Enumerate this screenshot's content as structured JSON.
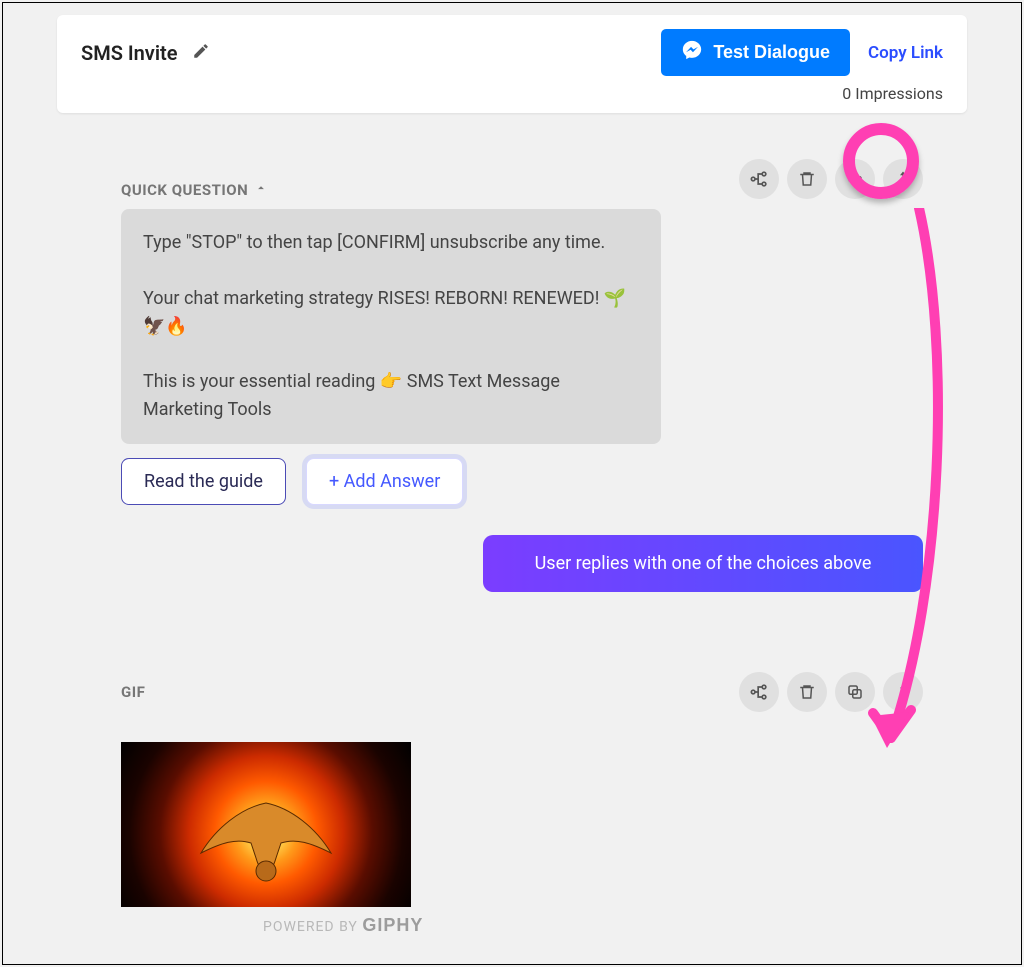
{
  "header": {
    "title": "SMS Invite",
    "test_button": "Test Dialogue",
    "copy_link": "Copy Link",
    "impressions": "0 Impressions"
  },
  "quick_question": {
    "label": "QUICK QUESTION",
    "message": "Type \"STOP\" to then tap [CONFIRM] unsubscribe any time.\n\nYour chat marketing strategy RISES! REBORN! RENEWED! 🌱🦅🔥\n\nThis is your essential reading 👉 SMS Text Message Marketing Tools",
    "answer_label": "Read the guide",
    "add_answer": "+ Add Answer"
  },
  "user_reply": "User replies with one of the choices above",
  "gif": {
    "label": "GIF",
    "powered": "POWERED BY",
    "brand": "GIPHY"
  }
}
